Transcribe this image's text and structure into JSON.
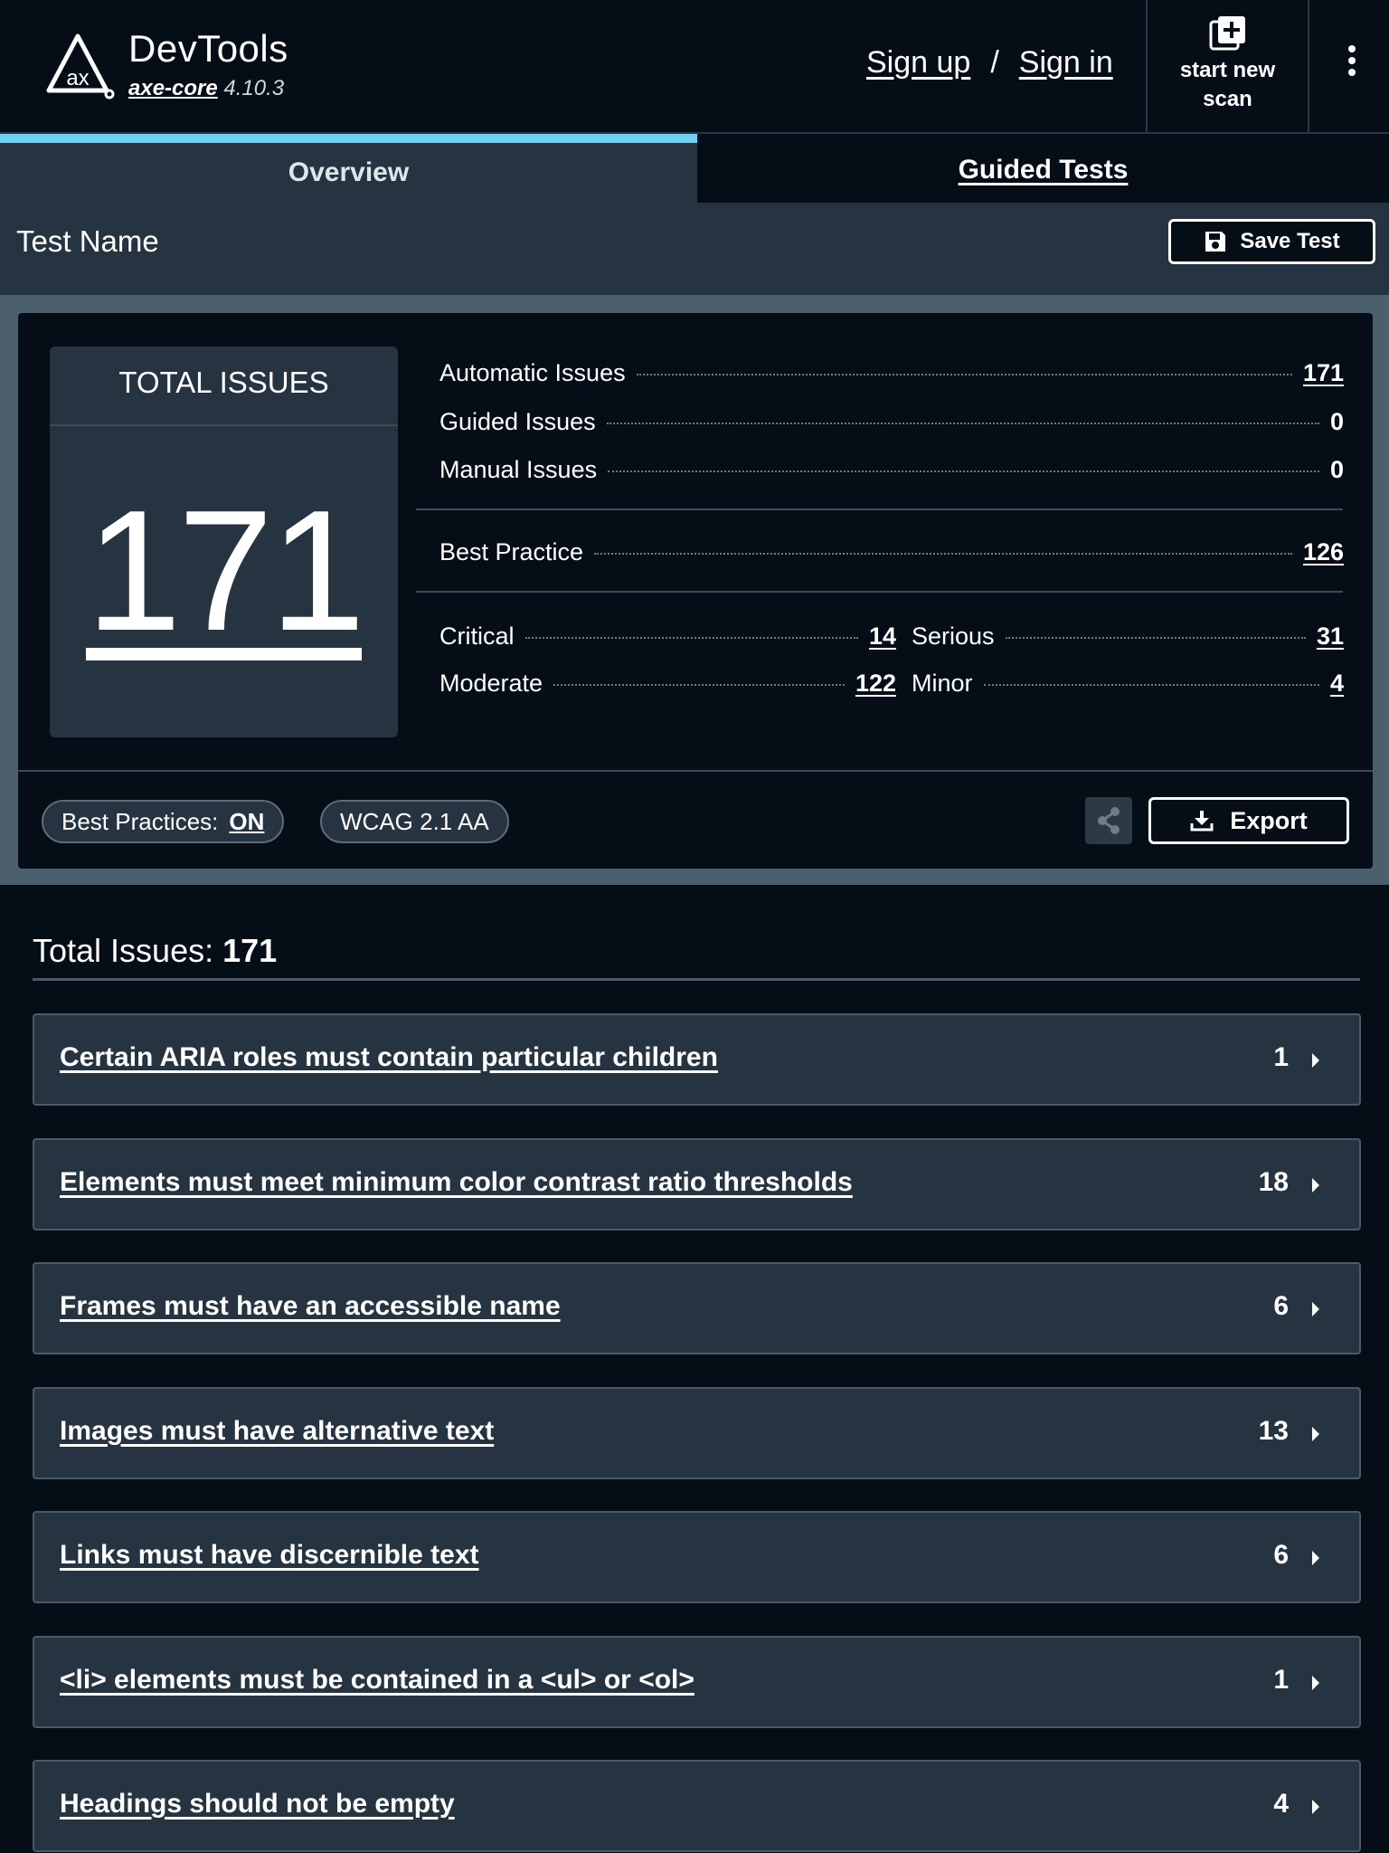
{
  "header": {
    "brand": "DevTools",
    "sub_core": "axe-core",
    "sub_version": "4.10.3",
    "signup": "Sign up",
    "separator": "/",
    "signin": "Sign in",
    "new_scan_line1": "start new",
    "new_scan_line2": "scan"
  },
  "tabs": [
    {
      "label": "Overview",
      "active": true
    },
    {
      "label": "Guided Tests",
      "active": false
    }
  ],
  "test": {
    "name": "Test Name",
    "save_label": "Save Test"
  },
  "summary": {
    "total_label": "TOTAL ISSUES",
    "total": "171",
    "automatic_label": "Automatic Issues",
    "automatic": "171",
    "guided_label": "Guided Issues",
    "guided": "0",
    "manual_label": "Manual Issues",
    "manual": "0",
    "best_practice_label": "Best Practice",
    "best_practice": "126",
    "critical_label": "Critical",
    "critical": "14",
    "serious_label": "Serious",
    "serious": "31",
    "moderate_label": "Moderate",
    "moderate": "122",
    "minor_label": "Minor",
    "minor": "4"
  },
  "footer": {
    "best_practices_label": "Best Practices:",
    "best_practices_value": "ON",
    "standard": "WCAG 2.1 AA",
    "export_label": "Export"
  },
  "issues_section": {
    "label": "Total Issues:",
    "count": "171"
  },
  "issues": [
    {
      "title": "Certain ARIA roles must contain particular children",
      "count": "1"
    },
    {
      "title": "Elements must meet minimum color contrast ratio thresholds",
      "count": "18"
    },
    {
      "title": "Frames must have an accessible name",
      "count": "6"
    },
    {
      "title": "Images must have alternative text",
      "count": "13"
    },
    {
      "title": "Links must have discernible text",
      "count": "6"
    },
    {
      "title": "<li> elements must be contained in a <ul> or <ol>",
      "count": "1"
    },
    {
      "title": "Headings should not be empty",
      "count": "4"
    }
  ],
  "colors": {
    "background": "#050e17",
    "panel": "#263441",
    "active_tab_accent": "#6fd1f1"
  }
}
